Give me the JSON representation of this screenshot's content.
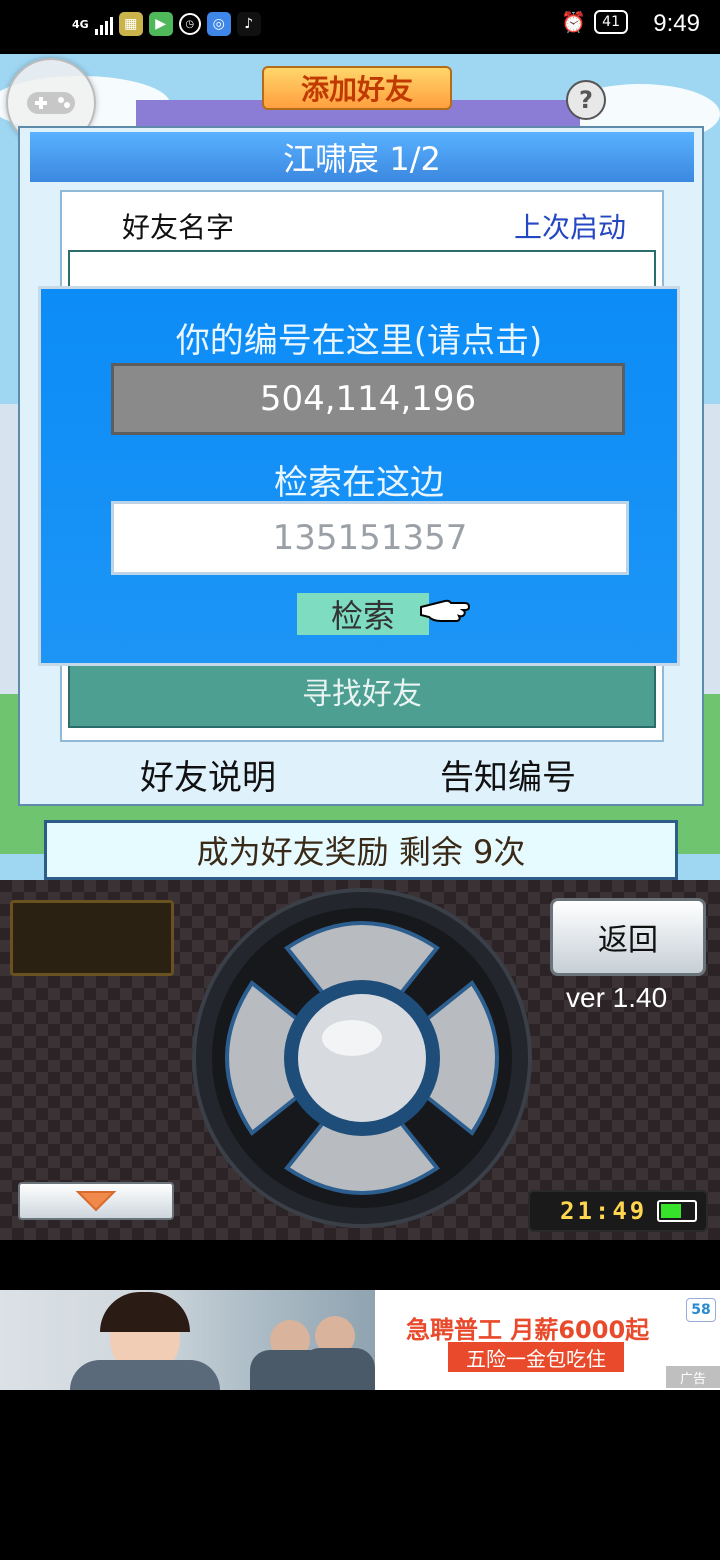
{
  "status_bar": {
    "network": "4G",
    "battery": "41",
    "time": "9:49"
  },
  "game": {
    "header_title": "添加好友",
    "panel": {
      "title": "江啸宸 1/2",
      "friend_name_header": "好友名字",
      "last_login_header": "上次启动",
      "find_friend_label": "寻找好友",
      "friend_guide_label": "好友说明",
      "notify_id_label": "告知编号"
    },
    "dialog": {
      "id_hint": "你的编号在这里(请点击)",
      "my_id": "504,114,196",
      "search_label": "检索在这边",
      "search_value": "135151357",
      "search_button": "检索"
    },
    "reward_text": "成为好友奖励 剩余 9次",
    "back_button": "返回",
    "version": "ver 1.40",
    "clock": "21:49"
  },
  "ad": {
    "headline": "急聘普工 月薪6000起",
    "subline": "五险一金包吃住",
    "logo": "58",
    "tag": "广告"
  }
}
